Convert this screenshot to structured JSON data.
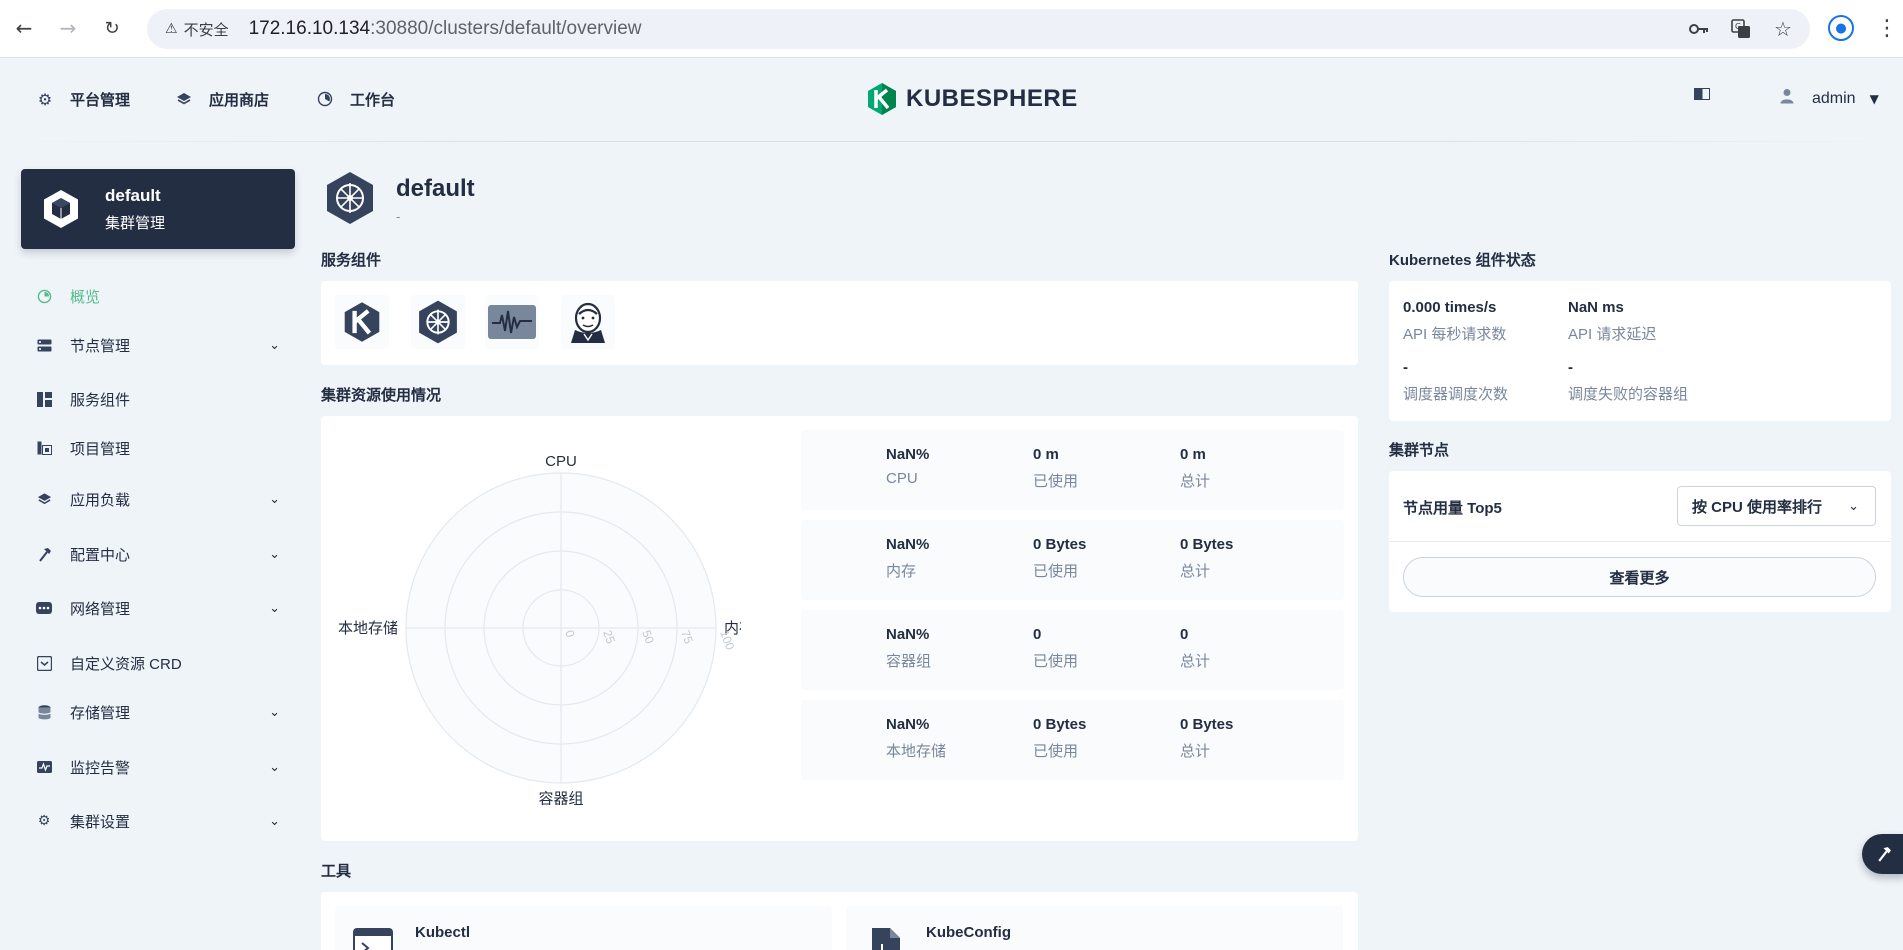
{
  "browser": {
    "security_label": "不安全",
    "url_host": "172.16.10.134",
    "url_rest": ":30880/clusters/default/overview"
  },
  "header": {
    "nav": [
      {
        "label": "平台管理",
        "icon": "gear-icon"
      },
      {
        "label": "应用商店",
        "icon": "layers-icon"
      },
      {
        "label": "工作台",
        "icon": "workbench-icon"
      }
    ],
    "logo_text": "KUBESPHERE",
    "user": "admin"
  },
  "cluster_card": {
    "name": "default",
    "subtitle": "集群管理"
  },
  "sidebar": {
    "items": [
      {
        "label": "概览",
        "icon": "dashboard-icon",
        "active": true
      },
      {
        "label": "节点管理",
        "icon": "server-icon",
        "expandable": true
      },
      {
        "label": "服务组件",
        "icon": "components-icon"
      },
      {
        "label": "项目管理",
        "icon": "project-icon"
      },
      {
        "label": "应用负载",
        "icon": "layers-icon",
        "expandable": true
      },
      {
        "label": "配置中心",
        "icon": "hammer-icon",
        "expandable": true
      },
      {
        "label": "网络管理",
        "icon": "network-icon",
        "expandable": true
      },
      {
        "label": "自定义资源 CRD",
        "icon": "crd-icon"
      },
      {
        "label": "存储管理",
        "icon": "database-icon",
        "expandable": true
      },
      {
        "label": "监控告警",
        "icon": "monitor-icon",
        "expandable": true
      },
      {
        "label": "集群设置",
        "icon": "gear-icon",
        "expandable": true
      }
    ]
  },
  "page": {
    "title": "default",
    "description": "-"
  },
  "service_components": {
    "title": "服务组件",
    "icons": [
      "kubesphere-icon",
      "kubernetes-icon",
      "monitoring-icon",
      "jenkins-icon"
    ]
  },
  "cluster_resources": {
    "title": "集群资源使用情况",
    "radar": {
      "axes": [
        "CPU",
        "内存",
        "容器组",
        "本地存储"
      ],
      "ring_labels": [
        "0",
        "25",
        "50",
        "75",
        "100"
      ]
    },
    "rows": [
      {
        "percent": "NaN%",
        "name": "CPU",
        "used": "0 m",
        "used_label": "已使用",
        "total": "0 m",
        "total_label": "总计"
      },
      {
        "percent": "NaN%",
        "name": "内存",
        "used": "0 Bytes",
        "used_label": "已使用",
        "total": "0 Bytes",
        "total_label": "总计"
      },
      {
        "percent": "NaN%",
        "name": "容器组",
        "used": "0",
        "used_label": "已使用",
        "total": "0",
        "total_label": "总计"
      },
      {
        "percent": "NaN%",
        "name": "本地存储",
        "used": "0 Bytes",
        "used_label": "已使用",
        "total": "0 Bytes",
        "total_label": "总计"
      }
    ]
  },
  "k8s_status": {
    "title": "Kubernetes 组件状态",
    "items": [
      {
        "value": "0.000 times/s",
        "label": "API 每秒请求数"
      },
      {
        "value": "NaN ms",
        "label": "API 请求延迟"
      },
      {
        "value": "-",
        "label": "调度器调度次数"
      },
      {
        "value": "-",
        "label": "调度失败的容器组"
      }
    ]
  },
  "cluster_nodes": {
    "title": "集群节点",
    "top5_label": "节点用量 Top5",
    "sort_select": "按 CPU 使用率排行",
    "more_button": "查看更多"
  },
  "tools": {
    "title": "工具",
    "items": [
      {
        "name": "Kubectl"
      },
      {
        "name": "KubeConfig"
      }
    ]
  }
}
